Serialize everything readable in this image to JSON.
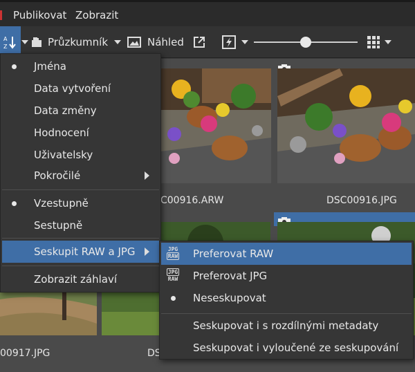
{
  "menubar": {
    "items": [
      "Publikovat",
      "Zobrazit"
    ]
  },
  "toolbar": {
    "sort_icon": "sort-az-icon",
    "browser_label": "Průzkumník",
    "preview_label": "Náhled",
    "open_external_icon": "external-link-icon",
    "quick_fix_icon": "lightning-icon",
    "grid_icon": "grid-icon",
    "zoom_slider_level": 0.5
  },
  "thumbnails": {
    "captions": [
      "C00916.ARW",
      "DSC00916.JPG",
      "00917.JPG",
      "DS"
    ],
    "selected_index": 3
  },
  "sort_menu": {
    "items": [
      {
        "label": "Jména",
        "checked": true
      },
      {
        "label": "Data vytvoření"
      },
      {
        "label": "Data změny"
      },
      {
        "label": "Hodnocení"
      },
      {
        "label": "Uživatelsky"
      },
      {
        "label": "Pokročilé",
        "submenu": true
      },
      {
        "label": "Vzestupně",
        "checked": true
      },
      {
        "label": "Sestupně"
      },
      {
        "label": "Seskupit RAW a JPG",
        "submenu": true,
        "highlighted": true
      },
      {
        "label": "Zobrazit záhlaví"
      }
    ]
  },
  "group_submenu": {
    "items": [
      {
        "label": "Preferovat RAW",
        "icon": "raw-jpg-icon",
        "highlighted": true
      },
      {
        "label": "Preferovat JPG",
        "icon": "jpg-raw-icon"
      },
      {
        "label": "Neseskupovat",
        "checked": true
      },
      {
        "label": "Seskupovat i s rozdílnými metadaty"
      },
      {
        "label": "Seskupovat i vyloučené ze seskupování"
      }
    ]
  },
  "colors": {
    "highlight": "#3f6ea6",
    "menu_bg": "#363636",
    "toolbar_bg": "#333333"
  }
}
